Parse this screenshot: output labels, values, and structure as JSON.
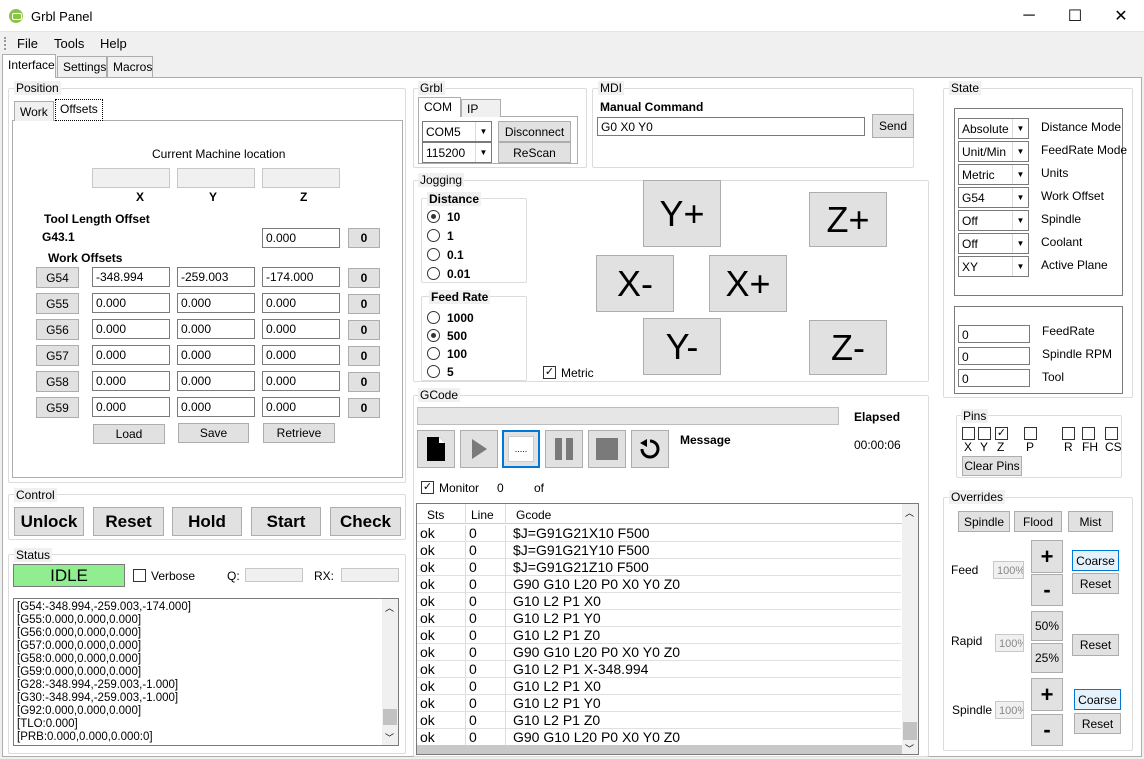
{
  "window": {
    "title": "Grbl Panel",
    "min": "─",
    "max": "☐",
    "close": "✕"
  },
  "menu": [
    "File",
    "Tools",
    "Help"
  ],
  "tabs": [
    "Interface",
    "Settings",
    "Macros"
  ],
  "position": {
    "group": "Position",
    "subtabs": [
      "Work",
      "Offsets"
    ],
    "current_label": "Current Machine location",
    "axes": [
      "X",
      "Y",
      "Z"
    ],
    "tlo_label": "Tool Length Offset",
    "g431": "G43.1",
    "tlo_value": "0.000",
    "zero": "0",
    "work_offsets_label": "Work Offsets",
    "rows": [
      {
        "name": "G54",
        "x": "-348.994",
        "y": "-259.003",
        "z": "-174.000"
      },
      {
        "name": "G55",
        "x": "0.000",
        "y": "0.000",
        "z": "0.000"
      },
      {
        "name": "G56",
        "x": "0.000",
        "y": "0.000",
        "z": "0.000"
      },
      {
        "name": "G57",
        "x": "0.000",
        "y": "0.000",
        "z": "0.000"
      },
      {
        "name": "G58",
        "x": "0.000",
        "y": "0.000",
        "z": "0.000"
      },
      {
        "name": "G59",
        "x": "0.000",
        "y": "0.000",
        "z": "0.000"
      }
    ],
    "load": "Load",
    "save": "Save",
    "retrieve": "Retrieve"
  },
  "control": {
    "group": "Control",
    "buttons": [
      "Unlock",
      "Reset",
      "Hold",
      "Start",
      "Check"
    ]
  },
  "status": {
    "group": "Status",
    "state": "IDLE",
    "verbose": "Verbose",
    "q": "Q:",
    "rx": "RX:",
    "log": [
      "[G54:-348.994,-259.003,-174.000]",
      "[G55:0.000,0.000,0.000]",
      "[G56:0.000,0.000,0.000]",
      "[G57:0.000,0.000,0.000]",
      "[G58:0.000,0.000,0.000]",
      "[G59:0.000,0.000,0.000]",
      "[G28:-348.994,-259.003,-1.000]",
      "[G30:-348.994,-259.003,-1.000]",
      "[G92:0.000,0.000,0.000]",
      "[TLO:0.000]",
      "[PRB:0.000,0.000,0.000:0]"
    ]
  },
  "grbl": {
    "group": "Grbl",
    "tabs": [
      "COM",
      "IP"
    ],
    "port": "COM5",
    "baud": "115200",
    "disconnect": "Disconnect",
    "rescan": "ReScan"
  },
  "mdi": {
    "group": "MDI",
    "label": "Manual Command",
    "value": "G0 X0 Y0",
    "send": "Send"
  },
  "jogging": {
    "group": "Jogging",
    "distance_label": "Distance",
    "distances": [
      "10",
      "1",
      "0.1",
      "0.01"
    ],
    "feed_label": "Feed Rate",
    "feeds": [
      "1000",
      "500",
      "100",
      "5"
    ],
    "metric": "Metric",
    "yplus": "Y+",
    "yminus": "Y-",
    "xplus": "X+",
    "xminus": "X-",
    "zplus": "Z+",
    "zminus": "Z-"
  },
  "gcode": {
    "group": "GCode",
    "elapsed_label": "Elapsed",
    "elapsed": "00:00:06",
    "message": "Message",
    "monitor": "Monitor",
    "count": "0",
    "of": "of",
    "headers": [
      "Sts",
      "Line",
      "Gcode"
    ],
    "rows": [
      [
        "ok",
        "0",
        "$J=G91G21X10 F500"
      ],
      [
        "ok",
        "0",
        "$J=G91G21Y10 F500"
      ],
      [
        "ok",
        "0",
        "$J=G91G21Z10 F500"
      ],
      [
        "ok",
        "0",
        "G90 G10 L20 P0 X0 Y0 Z0"
      ],
      [
        "ok",
        "0",
        "G10 L2 P1 X0"
      ],
      [
        "ok",
        "0",
        "G10 L2 P1 Y0"
      ],
      [
        "ok",
        "0",
        "G10 L2 P1 Z0"
      ],
      [
        "ok",
        "0",
        "G90 G10 L20 P0 X0 Y0 Z0"
      ],
      [
        "ok",
        "0",
        "G10 L2 P1 X-348.994"
      ],
      [
        "ok",
        "0",
        "G10 L2 P1 X0"
      ],
      [
        "ok",
        "0",
        "G10 L2 P1 Y0"
      ],
      [
        "ok",
        "0",
        "G10 L2 P1 Z0"
      ],
      [
        "ok",
        "0",
        "G90 G10 L20 P0 X0 Y0 Z0"
      ]
    ]
  },
  "state": {
    "group": "State",
    "modes": [
      {
        "value": "Absolute",
        "label": "Distance Mode"
      },
      {
        "value": "Unit/Min",
        "label": "FeedRate Mode"
      },
      {
        "value": "Metric",
        "label": "Units"
      },
      {
        "value": "G54",
        "label": "Work Offset"
      },
      {
        "value": "Off",
        "label": "Spindle"
      },
      {
        "value": "Off",
        "label": "Coolant"
      },
      {
        "value": "XY",
        "label": "Active Plane"
      }
    ],
    "feedrate": "0",
    "feedrate_label": "FeedRate",
    "rpm": "0",
    "rpm_label": "Spindle RPM",
    "tool": "0",
    "tool_label": "Tool"
  },
  "pins": {
    "group": "Pins",
    "labels": [
      "X",
      "Y",
      "Z",
      "P",
      "R",
      "FH",
      "CS"
    ],
    "clear": "Clear Pins"
  },
  "overrides": {
    "group": "Overrides",
    "spindle": "Spindle",
    "flood": "Flood",
    "mist": "Mist",
    "feed": "Feed",
    "feed_val": "100%",
    "rapid": "Rapid",
    "rapid_val": "100%",
    "spindle_label": "Spindle",
    "spindle_val": "100%",
    "plus": "+",
    "minus": "-",
    "coarse": "Coarse",
    "reset": "Reset",
    "p50": "50%",
    "p25": "25%"
  }
}
